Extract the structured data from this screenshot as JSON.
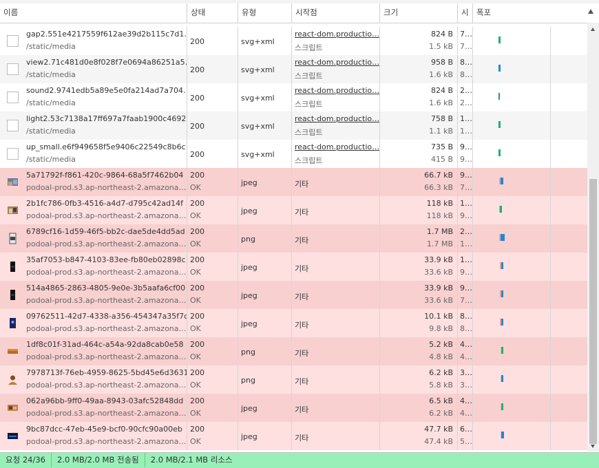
{
  "columns": [
    "이름",
    "상태",
    "유형",
    "시작점",
    "크기",
    "시",
    "폭포"
  ],
  "rows": [
    {
      "name": "gap2.551e4217559f612ae39d2b115c7d1…",
      "path": "/static/media",
      "status": "200",
      "status2": "",
      "type": "svg+xml",
      "initiator": "react-dom.productio…",
      "initiator2": "스크립트",
      "size1": "824 B",
      "size2": "1.5 kB",
      "time1": "7…",
      "time2": "7…",
      "thumb": "blank",
      "err": false
    },
    {
      "name": "view2.71c481d0e8f028f7e0694a86251a5…",
      "path": "/static/media",
      "status": "200",
      "status2": "",
      "type": "svg+xml",
      "initiator": "react-dom.productio…",
      "initiator2": "스크립트",
      "size1": "958 B",
      "size2": "1.6 kB",
      "time1": "8…",
      "time2": "8…",
      "thumb": "blank",
      "err": false
    },
    {
      "name": "sound2.9741edb5a89e5e0fa214ad7a704…",
      "path": "/static/media",
      "status": "200",
      "status2": "",
      "type": "svg+xml",
      "initiator": "react-dom.productio…",
      "initiator2": "스크립트",
      "size1": "824 B",
      "size2": "1.6 kB",
      "time1": "2…",
      "time2": "2…",
      "thumb": "blank",
      "err": false
    },
    {
      "name": "light2.53c7138a17ff697a7faab1900c4692…",
      "path": "/static/media",
      "status": "200",
      "status2": "",
      "type": "svg+xml",
      "initiator": "react-dom.productio…",
      "initiator2": "스크립트",
      "size1": "758 B",
      "size2": "1.1 kB",
      "time1": "1…",
      "time2": "1…",
      "thumb": "blank",
      "err": false
    },
    {
      "name": "up_small.e6f949658f5e9406c22549c8b6c…",
      "path": "/static/media",
      "status": "200",
      "status2": "",
      "type": "svg+xml",
      "initiator": "react-dom.productio…",
      "initiator2": "스크립트",
      "size1": "735 B",
      "size2": "415 B",
      "time1": "9…",
      "time2": "9…",
      "thumb": "blank",
      "err": false
    },
    {
      "name": "5a71792f-f861-420c-9864-68a5f7462b04",
      "path": "podoal-prod.s3.ap-northeast-2.amazona…",
      "status": "200",
      "status2": "OK",
      "type": "jpeg",
      "initiator": "기타",
      "initiator2": "",
      "size1": "66.7 kB",
      "size2": "66.3 kB",
      "time1": "9…",
      "time2": "7…",
      "thumb": "img1",
      "err": true
    },
    {
      "name": "2b1fc786-0fb3-4516-a4d7-d795c42ad14f",
      "path": "podoal-prod.s3.ap-northeast-2.amazona…",
      "status": "200",
      "status2": "OK",
      "type": "jpeg",
      "initiator": "기타",
      "initiator2": "",
      "size1": "118 kB",
      "size2": "118 kB",
      "time1": "1…",
      "time2": "9…",
      "thumb": "img2",
      "err": true
    },
    {
      "name": "6789cf16-1d59-46f5-bb2c-dae5de4dd5ad",
      "path": "podoal-prod.s3.ap-northeast-2.amazona…",
      "status": "200",
      "status2": "OK",
      "type": "png",
      "initiator": "기타",
      "initiator2": "",
      "size1": "1.7 MB",
      "size2": "1.7 MB",
      "time1": "2…",
      "time2": "1…",
      "thumb": "img3",
      "err": true
    },
    {
      "name": "35af7053-b847-4103-83ee-fb80eb02898c",
      "path": "podoal-prod.s3.ap-northeast-2.amazona…",
      "status": "200",
      "status2": "OK",
      "type": "jpeg",
      "initiator": "기타",
      "initiator2": "",
      "size1": "33.9 kB",
      "size2": "33.6 kB",
      "time1": "1…",
      "time2": "9…",
      "thumb": "img4",
      "err": true
    },
    {
      "name": "514a4865-2863-4805-9e0e-3b5aafa6cf00",
      "path": "podoal-prod.s3.ap-northeast-2.amazona…",
      "status": "200",
      "status2": "OK",
      "type": "jpeg",
      "initiator": "기타",
      "initiator2": "",
      "size1": "33.9 kB",
      "size2": "33.6 kB",
      "time1": "9…",
      "time2": "7…",
      "thumb": "img4",
      "err": true
    },
    {
      "name": "09762511-42d7-4338-a356-454347a35f7c",
      "path": "podoal-prod.s3.ap-northeast-2.amazona…",
      "status": "200",
      "status2": "OK",
      "type": "jpeg",
      "initiator": "기타",
      "initiator2": "",
      "size1": "10.1 kB",
      "size2": "9.8 kB",
      "time1": "8…",
      "time2": "8…",
      "thumb": "img5",
      "err": true
    },
    {
      "name": "1df8c01f-31ad-464c-a54a-92da8cab0e58",
      "path": "podoal-prod.s3.ap-northeast-2.amazona…",
      "status": "200",
      "status2": "OK",
      "type": "png",
      "initiator": "기타",
      "initiator2": "",
      "size1": "5.2 kB",
      "size2": "4.8 kB",
      "time1": "4…",
      "time2": "4…",
      "thumb": "img6",
      "err": true
    },
    {
      "name": "7978713f-76eb-4959-8625-5bd45e6d3631",
      "path": "podoal-prod.s3.ap-northeast-2.amazona…",
      "status": "200",
      "status2": "OK",
      "type": "png",
      "initiator": "기타",
      "initiator2": "",
      "size1": "6.2 kB",
      "size2": "5.8 kB",
      "time1": "3…",
      "time2": "3…",
      "thumb": "img7",
      "err": true
    },
    {
      "name": "062a96bb-9ff0-49aa-8943-03afc52848dd",
      "path": "podoal-prod.s3.ap-northeast-2.amazona…",
      "status": "200",
      "status2": "OK",
      "type": "jpeg",
      "initiator": "기타",
      "initiator2": "",
      "size1": "6.5 kB",
      "size2": "6.2 kB",
      "time1": "4…",
      "time2": "4…",
      "thumb": "img8",
      "err": true
    },
    {
      "name": "9bc87dcc-47eb-45e9-bcf0-90cfc90a00eb",
      "path": "podoal-prod.s3.ap-northeast-2.amazona…",
      "status": "200",
      "status2": "OK",
      "type": "jpeg",
      "initiator": "기타",
      "initiator2": "",
      "size1": "47.7 kB",
      "size2": "47.4 kB",
      "time1": "6…",
      "time2": "5…",
      "thumb": "img9",
      "err": true
    }
  ],
  "status_bar": {
    "requests": "요청 24/36",
    "transferred": "2.0 MB/2.0 MB 전송됨",
    "resources": "2.0 MB/2.1 MB 리소스"
  },
  "colors": {
    "error_row_odd": "#ffe0e0",
    "error_row_even": "#f8d0d0",
    "status_bar": "#98f0b8",
    "waterfall_blue": "#1a8ad8",
    "waterfall_green": "#1bb26e"
  }
}
